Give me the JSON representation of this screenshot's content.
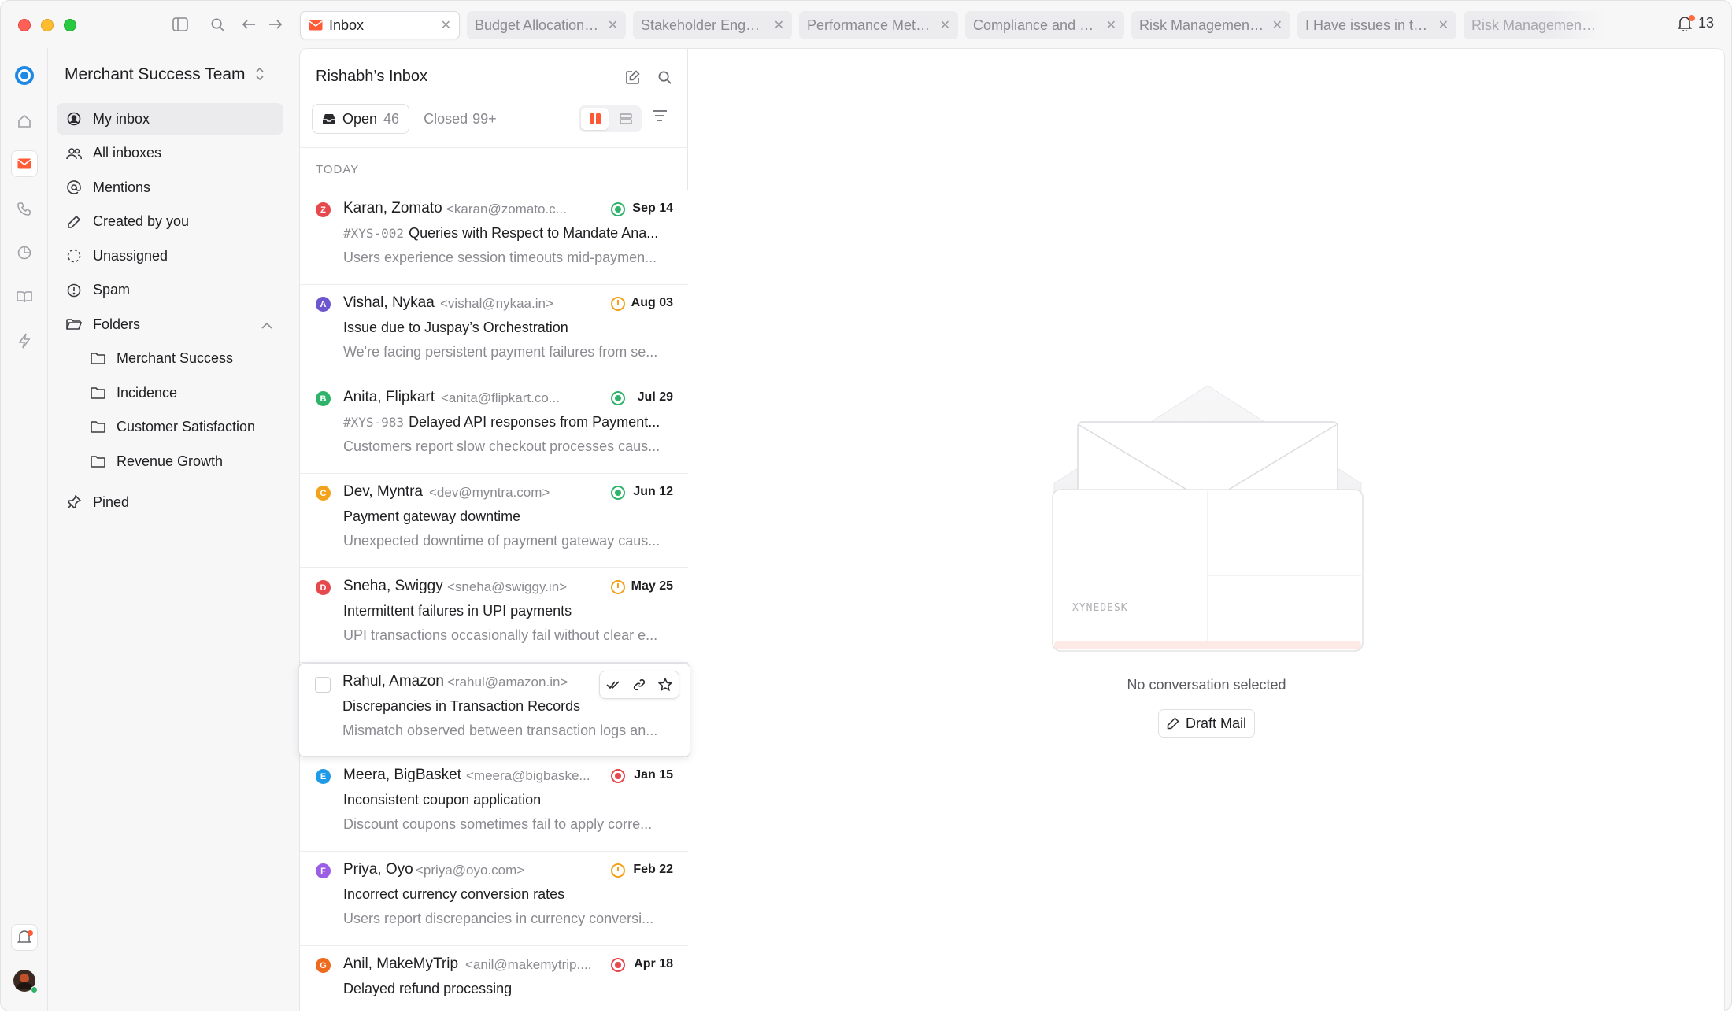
{
  "titlebar": {
    "tabs": [
      {
        "label": "Inbox",
        "active": true
      },
      {
        "label": "Budget Allocation f..."
      },
      {
        "label": "Stakeholder Engag..."
      },
      {
        "label": "Performance Metri..."
      },
      {
        "label": "Compliance and R..."
      },
      {
        "label": "Risk Management i..."
      },
      {
        "label": "I Have issues in tra..."
      },
      {
        "label": "Risk Management i..."
      }
    ],
    "notification_count": "13"
  },
  "sidebar": {
    "team_name": "Merchant Success Team",
    "items": [
      {
        "label": "My inbox",
        "icon": "user-circle-icon"
      },
      {
        "label": "All inboxes",
        "icon": "users-icon"
      },
      {
        "label": "Mentions",
        "icon": "at-icon"
      },
      {
        "label": "Created by you",
        "icon": "pencil-icon"
      },
      {
        "label": "Unassigned",
        "icon": "dashed-circle-icon"
      },
      {
        "label": "Spam",
        "icon": "alert-circle-icon"
      },
      {
        "label": "Folders",
        "icon": "folder-open-icon"
      }
    ],
    "folders": [
      {
        "label": "Merchant Success"
      },
      {
        "label": "Incidence"
      },
      {
        "label": "Customer Satisfaction"
      },
      {
        "label": "Revenue Growth"
      }
    ],
    "pinned_label": "Pined"
  },
  "list": {
    "title": "Rishabh’s Inbox",
    "open_label": "Open",
    "open_count": "46",
    "closed_label": "Closed",
    "closed_count": "99+",
    "section_label": "TODAY",
    "colors": {
      "accent": "#ff5a36",
      "green": "#2fb36a",
      "orange": "#f2a21b",
      "red": "#e5484d"
    },
    "rows": [
      {
        "initial": "Z",
        "avatar_color": "#e5484d",
        "from": "Karan, Zomato",
        "email": "<karan@zomato.c...",
        "status": "green",
        "date": "Sep 14",
        "tag": "#XYS-002",
        "subject": "Queries with Respect to Mandate Ana...",
        "preview": "Users experience session timeouts mid-paymen..."
      },
      {
        "initial": "A",
        "avatar_color": "#6e56cf",
        "from": "Vishal, Nykaa",
        "email": "<vishal@nykaa.in>",
        "status": "orange",
        "date": "Aug 03",
        "tag": "",
        "subject": "Issue due to Juspay’s Orchestration",
        "preview": "We're facing persistent payment failures from se..."
      },
      {
        "initial": "B",
        "avatar_color": "#2fb36a",
        "from": "Anita, Flipkart",
        "email": "<anita@flipkart.co...",
        "status": "green",
        "date": "Jul 29",
        "tag": "#XYS-983",
        "subject": "Delayed API responses from Payment...",
        "preview": "Customers report slow checkout processes caus..."
      },
      {
        "initial": "C",
        "avatar_color": "#f2a21b",
        "from": "Dev, Myntra",
        "email": "<dev@myntra.com>",
        "status": "green",
        "date": "Jun 12",
        "tag": "",
        "subject": "Payment gateway downtime",
        "preview": "Unexpected downtime of payment gateway caus..."
      },
      {
        "initial": "D",
        "avatar_color": "#e5484d",
        "from": "Sneha, Swiggy",
        "email": "<sneha@swiggy.in>",
        "status": "orange",
        "date": "May 25",
        "tag": "",
        "subject": "Intermittent failures in UPI payments",
        "preview": "UPI transactions occasionally fail without clear e..."
      },
      {
        "initial": "",
        "avatar_color": "",
        "from": "Rahul, Amazon",
        "email": "<rahul@amazon.in>",
        "status": "",
        "date": "",
        "tag": "",
        "subject": "Discrepancies in Transaction Records",
        "preview": "Mismatch observed between transaction logs an...",
        "hovered": true
      },
      {
        "initial": "E",
        "avatar_color": "#1e9be8",
        "from": "Meera, BigBasket",
        "email": "<meera@bigbaske...",
        "status": "red",
        "date": "Jan 15",
        "tag": "",
        "subject": "Inconsistent coupon application",
        "preview": "Discount coupons sometimes fail to apply corre..."
      },
      {
        "initial": "F",
        "avatar_color": "#9b5de5",
        "from": "Priya, Oyo",
        "email": "<priya@oyo.com>",
        "status": "orange",
        "date": "Feb 22",
        "tag": "",
        "subject": "Incorrect currency conversion rates",
        "preview": "Users report discrepancies in currency conversi..."
      },
      {
        "initial": "G",
        "avatar_color": "#f06a1d",
        "from": "Anil, MakeMyTrip",
        "email": "<anil@makemytrip....",
        "status": "red",
        "date": "Apr 18",
        "tag": "",
        "subject": "Delayed refund processing",
        "preview": ""
      }
    ]
  },
  "detail": {
    "brand_label": "XYNEDESK",
    "empty_label": "No conversation selected",
    "draft_label": "Draft Mail"
  }
}
